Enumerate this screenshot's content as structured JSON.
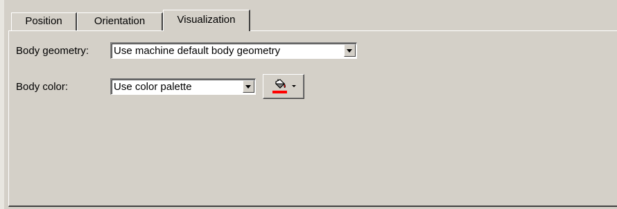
{
  "tabs": [
    {
      "label": "Position"
    },
    {
      "label": "Orientation"
    },
    {
      "label": "Visualization",
      "active": true
    }
  ],
  "body_geometry": {
    "label": "Body geometry:",
    "value": "Use machine default body geometry"
  },
  "body_color": {
    "label": "Body color:",
    "value": "Use color palette",
    "swatch_color": "#ff0000",
    "button_icon": "paint-bucket-icon"
  },
  "colors": {
    "background": "#d4d0c8",
    "accent_swatch": "#ff0000"
  }
}
